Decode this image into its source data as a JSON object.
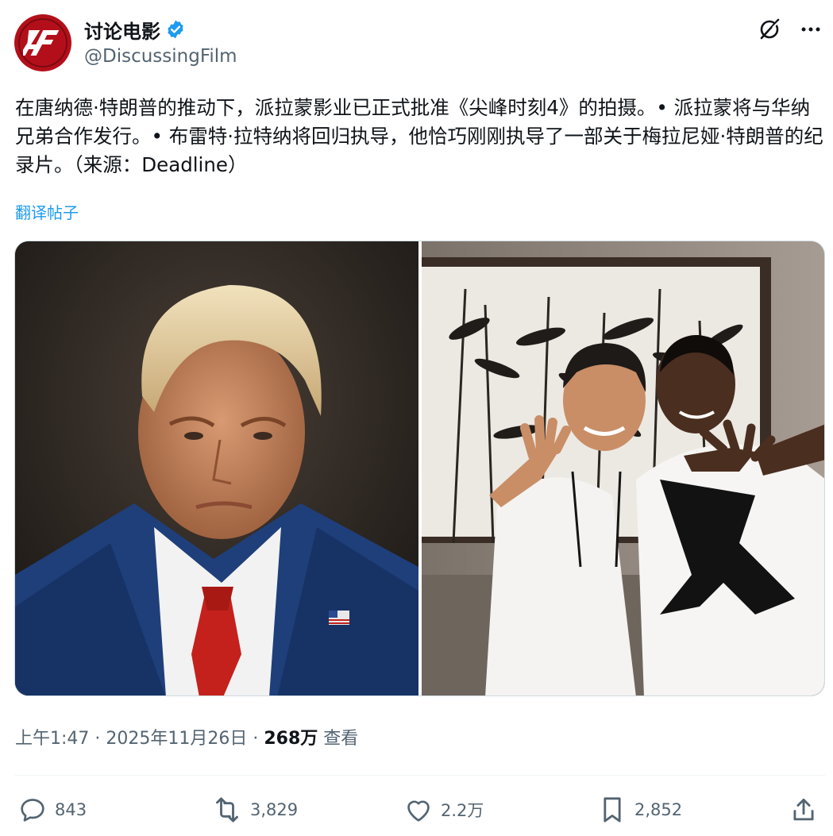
{
  "author": {
    "display_name": "讨论电影",
    "handle": "@DiscussingFilm",
    "avatar_text": "DF",
    "verified": true
  },
  "header_actions": {
    "grok_icon": "grok-icon",
    "more_icon": "more-icon"
  },
  "post": {
    "text": "在唐纳德·特朗普的推动下，派拉蒙影业已正式批准《尖峰时刻4》的拍摄。• 派拉蒙将与华纳兄弟合作发行。• 布雷特·拉特纳将回归执导，他恰巧刚刚执导了一部关于梅拉尼娅·特朗普的纪录片。（来源：Deadline）",
    "translate_label": "翻译帖子"
  },
  "meta": {
    "time": "上午1:47",
    "sep1": " · ",
    "date": "2025年11月26日",
    "sep2": " · ",
    "views_count": "268万",
    "views_label": " 查看"
  },
  "actions": {
    "replies": "843",
    "reposts": "3,829",
    "likes": "2.2万",
    "bookmarks": "2,852"
  },
  "colors": {
    "accent": "#1d9bf0",
    "text_primary": "#0f1419",
    "text_secondary": "#536471",
    "avatar_bg": "#b30f1a"
  }
}
